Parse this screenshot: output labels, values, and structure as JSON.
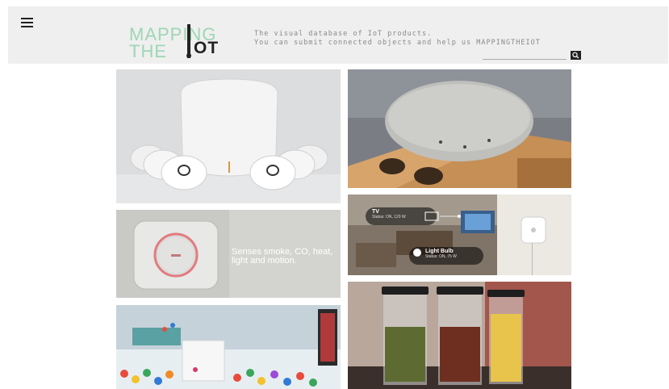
{
  "header": {
    "logo": {
      "line1": "MAPPING",
      "line2": "THE",
      "brand": "OT"
    },
    "tagline_line1": "The visual database of IoT products.",
    "tagline_line2": "You can submit connected objects and help us MAPPINGTHEIOT"
  },
  "search": {
    "placeholder": ""
  },
  "tiles": [
    {
      "id": "smart-home-kit"
    },
    {
      "id": "speaker-puck"
    },
    {
      "id": "smoke-alarm",
      "caption": "Senses smoke, CO, heat,\nlight and motion."
    },
    {
      "id": "sensor-remote",
      "tv_label": "TV",
      "tv_status": "Status: ON, 120 W",
      "bulb_label": "Light Bulb",
      "bulb_status": "Status: ON, 75 W"
    },
    {
      "id": "cube-candies"
    },
    {
      "id": "smart-jars"
    }
  ],
  "colors": {
    "accent": "#9ed6b4",
    "dark": "#222222"
  }
}
